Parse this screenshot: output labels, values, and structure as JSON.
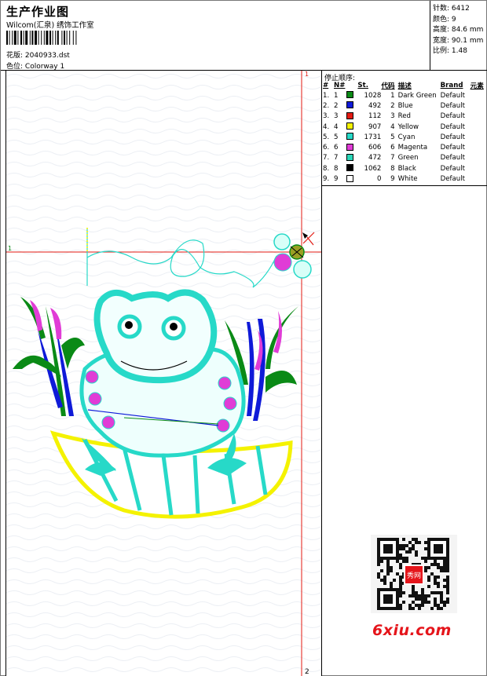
{
  "header": {
    "title": "生产作业图",
    "company": "Wilcom(汇泉) 绣饰工作室",
    "design_label": "花版:",
    "design_value": "2040933.dst",
    "colorway_label": "色位:",
    "colorway_value": "Colorway 1"
  },
  "stats": [
    {
      "label": "针数:",
      "value": "6412"
    },
    {
      "label": "颜色:",
      "value": "9"
    },
    {
      "label": "高度:",
      "value": "84.6 mm"
    },
    {
      "label": "宽度:",
      "value": "90.1 mm"
    },
    {
      "label": "比例:",
      "value": "1.48"
    }
  ],
  "canvas": {
    "marker_top": "1",
    "marker_bottom": "2",
    "marker_left": "1"
  },
  "color_table": {
    "title": "停止顺序:",
    "headers": {
      "idx": "#",
      "no": "N#",
      "st": "St.",
      "code": "代码",
      "desc": "描述",
      "brand": "Brand",
      "elem": "元素"
    },
    "rows": [
      {
        "idx": "1.",
        "no": "1",
        "color": "#0a8a16",
        "st": "1028",
        "code": "1",
        "desc": "Dark Green",
        "brand": "Default"
      },
      {
        "idx": "2.",
        "no": "2",
        "color": "#0f1ad8",
        "st": "492",
        "code": "2",
        "desc": "Blue",
        "brand": "Default"
      },
      {
        "idx": "3.",
        "no": "3",
        "color": "#e31a12",
        "st": "112",
        "code": "3",
        "desc": "Red",
        "brand": "Default"
      },
      {
        "idx": "4.",
        "no": "4",
        "color": "#f4f200",
        "st": "907",
        "code": "4",
        "desc": "Yellow",
        "brand": "Default"
      },
      {
        "idx": "5.",
        "no": "5",
        "color": "#27d9c8",
        "st": "1731",
        "code": "5",
        "desc": "Cyan",
        "brand": "Default"
      },
      {
        "idx": "6.",
        "no": "6",
        "color": "#e03cd6",
        "st": "606",
        "code": "6",
        "desc": "Magenta",
        "brand": "Default"
      },
      {
        "idx": "7.",
        "no": "7",
        "color": "#2ad7b8",
        "st": "472",
        "code": "7",
        "desc": "Green",
        "brand": "Default"
      },
      {
        "idx": "8.",
        "no": "8",
        "color": "#000000",
        "st": "1062",
        "code": "8",
        "desc": "Black",
        "brand": "Default"
      },
      {
        "idx": "9.",
        "no": "9",
        "color": "#ffffff",
        "st": "0",
        "code": "9",
        "desc": "White",
        "brand": "Default"
      }
    ]
  },
  "logo": {
    "text": "6xiu.com",
    "qr_text": "秀网"
  }
}
